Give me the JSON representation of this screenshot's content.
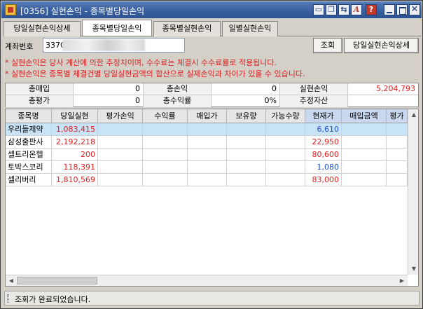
{
  "window": {
    "title": "[0356] 실현손익 - 종목별당일손익",
    "buttons": [
      "window-list",
      "window-copy",
      "link",
      "font",
      "help",
      "minimize",
      "maximize",
      "close"
    ],
    "help_glyph": "?",
    "font_glyph": "A"
  },
  "tabs": [
    {
      "label": "당일실현손익상세",
      "active": false
    },
    {
      "label": "종목별당일손익",
      "active": true
    },
    {
      "label": "종목별실현손익",
      "active": false
    },
    {
      "label": "일별실현손익",
      "active": false
    }
  ],
  "account": {
    "label": "계좌번호",
    "value": "3370-",
    "query_button": "조회",
    "detail_button": "당일실현손익상세"
  },
  "notices": [
    "* 실현손익은 당사 계산에 의한 추정치이며, 수수료는 체결시 수수료률로 적용됩니다.",
    "* 실현손익은 종목별 체결건별 당일실현금액의 합산으로 실제손익과 차이가 있을 수 있습니다."
  ],
  "summary": {
    "labels": {
      "buy_total": "총매입",
      "pl_total": "총손익",
      "realized": "실현손익",
      "eval_total": "총평가",
      "rate_total": "총수익률",
      "est_assets": "추정자산"
    },
    "values": {
      "buy_total": "0",
      "pl_total": "0",
      "realized": "5,204,793",
      "eval_total": "0",
      "rate_total": "0%",
      "est_assets": ""
    }
  },
  "grid": {
    "columns": [
      "종목명",
      "당일실현",
      "평가손익",
      "수익률",
      "매입가",
      "보유량",
      "가능수량",
      "현재가",
      "매입금액",
      "평가"
    ],
    "rows": [
      {
        "name": "우리들제약",
        "realized": "1,083,415",
        "price": "6,610"
      },
      {
        "name": "삼성출판사",
        "realized": "2,192,218",
        "price": "22,950"
      },
      {
        "name": "셀트리온헬",
        "realized": "200",
        "price": "80,600"
      },
      {
        "name": "토박스코리",
        "realized": "118,391",
        "price": "1,080"
      },
      {
        "name": "셀리버리",
        "realized": "1,810,569",
        "price": "83,000"
      }
    ],
    "selected_row": 0
  },
  "colors": {
    "gain_red": "#e02020",
    "loss_blue": "#1f50c8",
    "price_colors": [
      "blue",
      "red",
      "red",
      "blue",
      "red"
    ]
  },
  "status": {
    "text": "조회가 완료되었습니다."
  }
}
